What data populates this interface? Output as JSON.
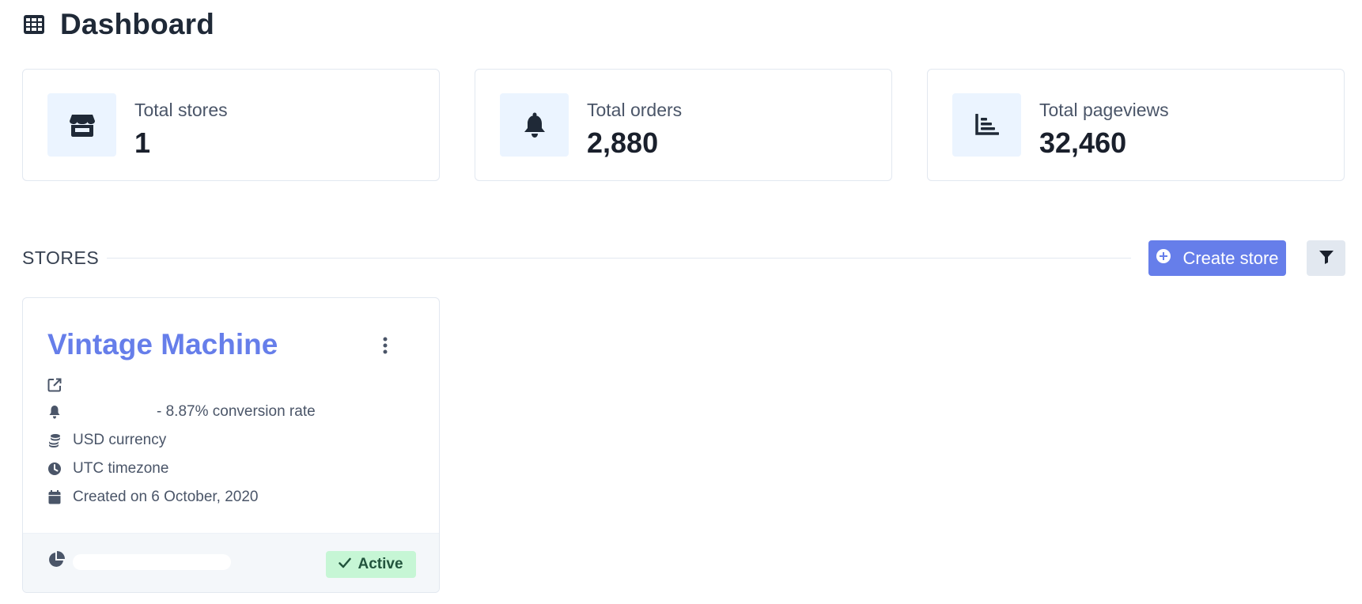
{
  "header": {
    "title": "Dashboard",
    "icon": "table-grid-icon"
  },
  "stats": [
    {
      "label": "Total stores",
      "value": "1",
      "icon": "store-icon"
    },
    {
      "label": "Total orders",
      "value": "2,880",
      "icon": "bell-icon"
    },
    {
      "label": "Total pageviews",
      "value": "32,460",
      "icon": "bar-chart-icon"
    }
  ],
  "stores_section": {
    "title": "STORES",
    "create_label": "Create store",
    "filter_icon": "filter-icon"
  },
  "store_card": {
    "name": "Vintage Machine",
    "orders_text": "- 8.87% conversion rate",
    "currency_text": "USD currency",
    "timezone_text": "UTC timezone",
    "created_text": "Created on 6 October, 2020",
    "status_label": "Active"
  },
  "colors": {
    "accent": "#667eea",
    "icon_bg": "#ebf4ff",
    "badge_bg": "#c6f6d5",
    "badge_text": "#22543d",
    "footer_bg": "#f4f7fa"
  }
}
